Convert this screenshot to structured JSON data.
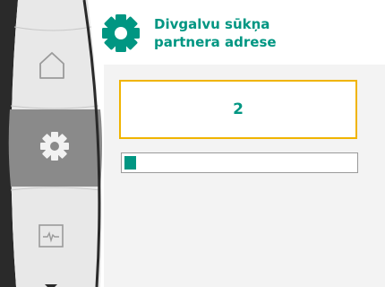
{
  "header": {
    "icon": "gear-icon",
    "title_line1": "Divgalvu sūkņa",
    "title_line2": "partnera adrese"
  },
  "sidebar": {
    "items": [
      {
        "icon": "home-icon",
        "selected": false
      },
      {
        "icon": "gear-icon",
        "selected": true
      },
      {
        "icon": "diagnostics-icon",
        "selected": false
      }
    ],
    "scroll_indicator": "arrow-down-icon"
  },
  "main": {
    "value": "2",
    "progress_fraction": 0.05
  },
  "colors": {
    "accent": "#009682",
    "focus": "#f0b400",
    "sidebar_bg": "#e8e8e8",
    "sidebar_selected": "#8a8a8a",
    "frame_dark": "#2a2a2a",
    "content_bg": "#f3f3f3"
  }
}
